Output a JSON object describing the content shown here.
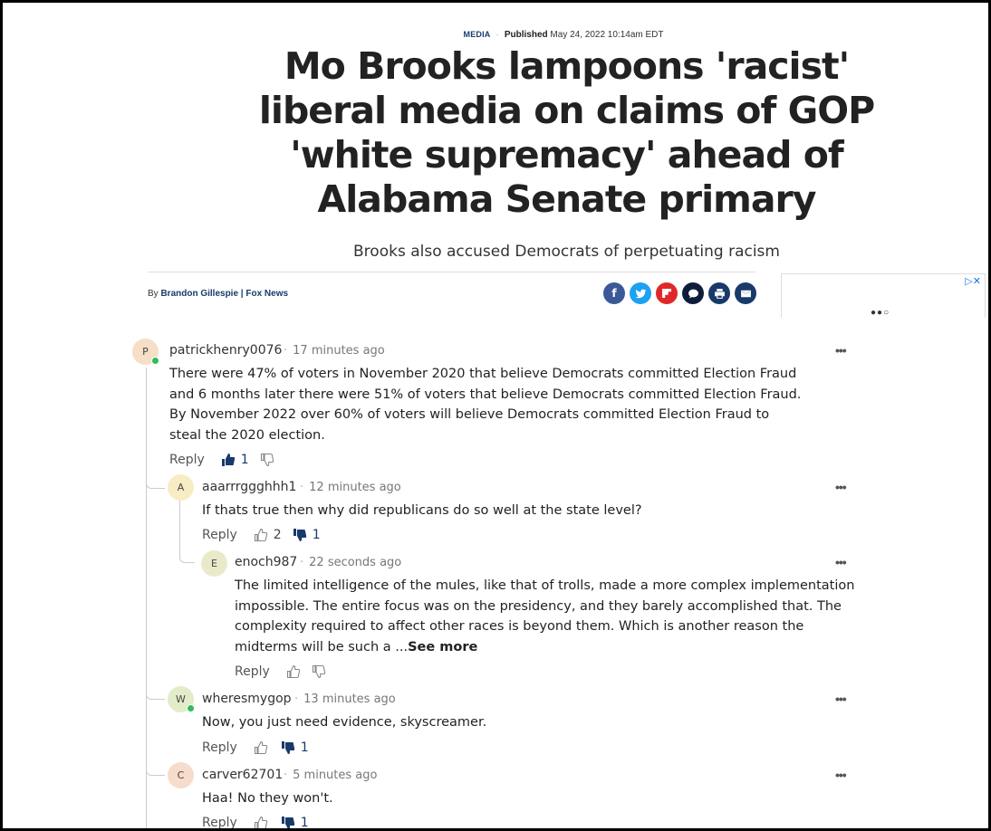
{
  "article": {
    "category": "MEDIA",
    "published_label": "Published",
    "published_date": "May 24, 2022 10:14am EDT",
    "headline": "Mo Brooks lampoons 'racist' liberal media on claims of GOP 'white supremacy' ahead of Alabama Senate primary",
    "subhead": "Brooks also accused Democrats of perpetuating racism",
    "byline_prefix": "By",
    "author": "Brandon Gillespie | Fox News"
  },
  "share": {
    "icons": [
      "facebook-icon",
      "twitter-icon",
      "flipboard-icon",
      "comment-icon",
      "print-icon",
      "email-icon"
    ],
    "colors": [
      "#3b5998",
      "#1da1f2",
      "#e12828",
      "#0f1d3d",
      "#183a6b",
      "#183a6b"
    ],
    "glyphs": [
      "f",
      "t",
      "F",
      "💬",
      "⎙",
      "✉"
    ]
  },
  "ad": {
    "close_glyph": "▷✕",
    "dots": "●●○"
  },
  "comments": [
    {
      "avatar_letter": "P",
      "avatar_color": "#f7dec7",
      "online": true,
      "user": "patrickhenry0076",
      "time": "17 minutes ago",
      "body": "There were 47% of voters in November 2020 that believe Democrats committed Election Fraud and 6 months later there were 51% of voters that believe Democrats committed Election Fraud. By November 2022 over 60% of voters will believe Democrats committed Election Fraud to steal the 2020 election.",
      "reply": "Reply",
      "likes": "1",
      "dislikes": "",
      "liked": true,
      "disliked": false
    },
    {
      "avatar_letter": "A",
      "avatar_color": "#f8ecc4",
      "online": false,
      "user": "aaarrrggghhh1",
      "time": "12 minutes ago",
      "body": "If thats true then why did republicans do so well at the state level?",
      "reply": "Reply",
      "likes": "2",
      "dislikes": "1",
      "liked": false,
      "disliked": true
    },
    {
      "avatar_letter": "E",
      "avatar_color": "#eaeacb",
      "online": false,
      "user": "enoch987",
      "time": "22 seconds ago",
      "body": "The limited intelligence of the mules, like that of trolls, made a more complex implementation impossible.  The entire focus was on the presidency, and they barely accomplished that.  The complexity required to affect other races is beyond them.  Which is another reason the midterms will be such a ...",
      "see_more": "See more",
      "reply": "Reply",
      "likes": "",
      "dislikes": "",
      "liked": false,
      "disliked": false
    },
    {
      "avatar_letter": "W",
      "avatar_color": "#e3ecc8",
      "online": true,
      "user": "wheresmygop",
      "time": "13 minutes ago",
      "body": "Now, you just need evidence, skyscreamer.",
      "reply": "Reply",
      "likes": "",
      "dislikes": "1",
      "liked": false,
      "disliked": true
    },
    {
      "avatar_letter": "C",
      "avatar_color": "#f6dccb",
      "online": false,
      "user": "carver62701",
      "time": "5 minutes ago",
      "body": "Haa! No they won't.",
      "reply": "Reply",
      "likes": "",
      "dislikes": "1",
      "liked": false,
      "disliked": true
    }
  ],
  "more_glyph": "•••"
}
